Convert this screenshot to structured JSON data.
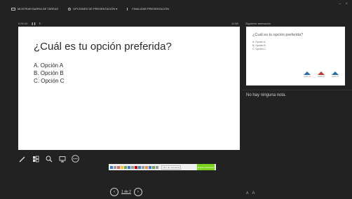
{
  "window": {
    "controls": [
      "–",
      "×"
    ]
  },
  "toolbar": {
    "items": [
      {
        "label": "MOSTRAR BARRA DE TAREAS",
        "icon": "taskbar-icon"
      },
      {
        "label": "OPCIONES DE PRESENTACIÓN ▾",
        "icon": "display-settings-icon"
      },
      {
        "label": "FINALIZAR PRESENTACIÓN",
        "icon": "end-show-icon"
      }
    ]
  },
  "status": {
    "elapsed": "0:00:10",
    "clock": "11:58"
  },
  "next": {
    "label": "Siguiente animación"
  },
  "slide": {
    "title": "¿Cuál es tu opción preferida?",
    "options": [
      "A.  Opción A",
      "B.  Opción B",
      "C.  Opción C"
    ]
  },
  "preview": {
    "title": "¿Cuál es tu opción preferida?",
    "options": [
      "A. Opción A",
      "B. Opción B",
      "C. Opción C"
    ],
    "logos": [
      {
        "label": "opción A",
        "color": "#2e6da4"
      },
      {
        "label": "opción B",
        "color": "#c0392b"
      },
      {
        "label": "opción C",
        "color": "#2e6da4"
      }
    ]
  },
  "tools": [
    "pen-icon",
    "slides-grid-icon",
    "zoom-icon",
    "monitor-icon",
    "more-options-icon"
  ],
  "taskbar": {
    "field_text": "Intro de respuesta",
    "action_label": "Enviar respuesta"
  },
  "navigation": {
    "page": "1 de 2",
    "prev_icon": "‹",
    "next_icon": "›"
  },
  "notes": {
    "text": "No hay ninguna nota."
  },
  "bottom": {
    "zoom_out": "A",
    "zoom_in": "A"
  }
}
